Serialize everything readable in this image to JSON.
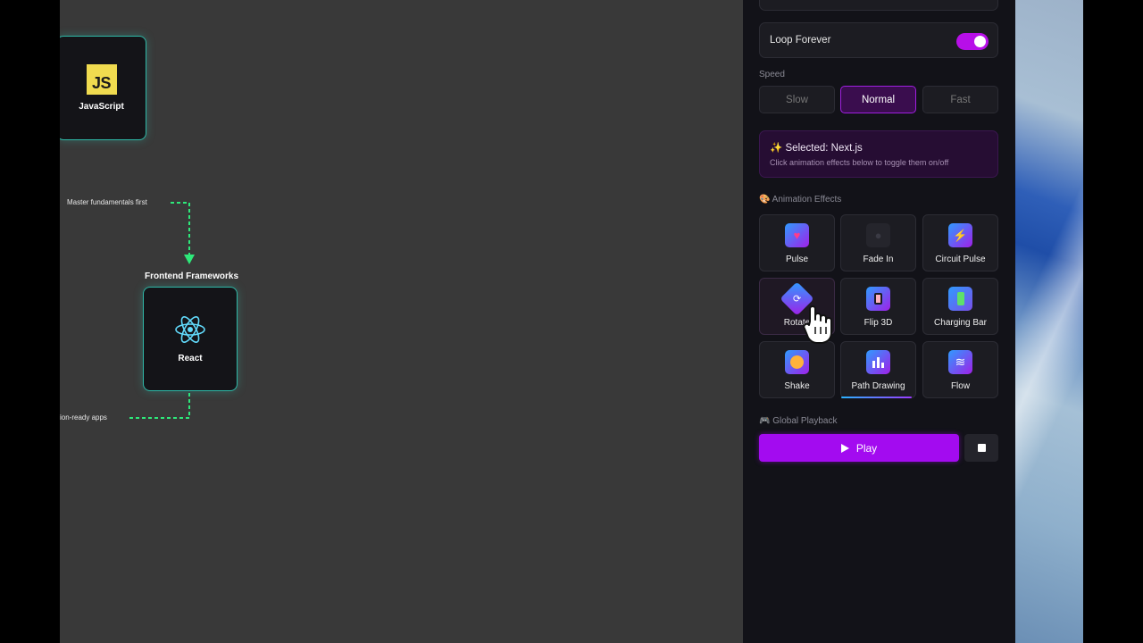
{
  "canvas": {
    "nodes": [
      {
        "label": "JavaScript",
        "icon": "js-logo",
        "badge_text": "JS"
      },
      {
        "label": "React",
        "icon": "react-icon",
        "group_label": "Frontend Frameworks"
      }
    ],
    "edge_labels": [
      "Master fundamentals first",
      "ion-ready apps"
    ]
  },
  "panel": {
    "loop_forever": {
      "label": "Loop Forever",
      "enabled": true
    },
    "speed": {
      "label": "Speed",
      "options": [
        "Slow",
        "Normal",
        "Fast"
      ],
      "selected": "Normal"
    },
    "selected_info": {
      "title": "✨ Selected: Next.js",
      "hint": "Click animation effects below to toggle them on/off"
    },
    "effects": {
      "label": "🎨 Animation Effects",
      "items": [
        {
          "label": "Pulse",
          "icon": "heart-icon"
        },
        {
          "label": "Fade In",
          "icon": "fade-icon"
        },
        {
          "label": "Circuit Pulse",
          "icon": "lightning-icon"
        },
        {
          "label": "Rotate",
          "icon": "rotate-icon"
        },
        {
          "label": "Flip 3D",
          "icon": "flip-icon"
        },
        {
          "label": "Charging Bar",
          "icon": "battery-icon"
        },
        {
          "label": "Shake",
          "icon": "shake-icon"
        },
        {
          "label": "Path Drawing",
          "icon": "chart-icon"
        },
        {
          "label": "Flow",
          "icon": "wave-icon"
        }
      ]
    },
    "playback": {
      "label": "🎮 Global Playback",
      "play_label": "Play"
    }
  },
  "colors": {
    "accent": "#a30bf0",
    "node_border": "#2fb7a6",
    "edge": "#2ee87a",
    "canvas_bg": "#393939",
    "panel_bg": "#121218"
  }
}
